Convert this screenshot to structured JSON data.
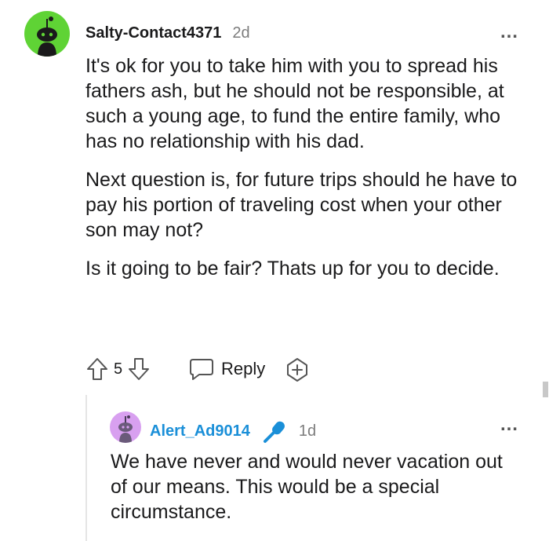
{
  "comments": [
    {
      "username": "Salty-Contact4371",
      "age": "2d",
      "avatar_color": "#5fd335",
      "paragraphs": [
        "It's ok for you to take him with you to spread his fathers ash, but he should not be responsible, at such a young age, to fund the entire family, who has no relationship with his dad.",
        "Next question is, for future trips should he have to pay his portion of traveling cost when your other son may not?",
        "Is it going to be fair? Thats up for you to decide."
      ],
      "vote_count": "5",
      "reply_label": "Reply"
    },
    {
      "username": "Alert_Ad9014",
      "age": "1d",
      "avatar_color": "#d8a0f0",
      "username_color": "#1a8fd8",
      "badge_icon": "microphone-icon",
      "paragraphs": [
        "We have never and would never vacation out of our means. This would be a special circumstance."
      ]
    }
  ],
  "icons": {
    "more": "…",
    "upvote": "upvote-arrow-icon",
    "downvote": "downvote-arrow-icon",
    "reply": "speech-bubble-icon",
    "award": "add-award-icon"
  }
}
